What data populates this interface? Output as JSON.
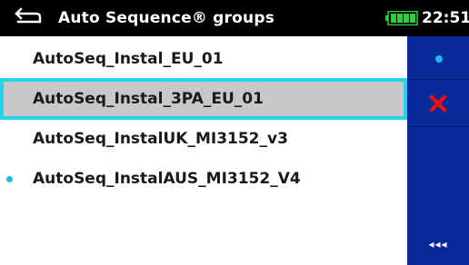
{
  "header": {
    "back_icon": "back-arrow-icon",
    "title": "Auto Sequence® groups",
    "battery_icon": "battery-full-icon",
    "battery_color": "#2dcf3a",
    "time": "22:51"
  },
  "list": {
    "items": [
      {
        "label": "AutoSeq_Instal_EU_01",
        "selected": false,
        "active": false
      },
      {
        "label": "AutoSeq_Instal_3PA_EU_01",
        "selected": true,
        "active": false
      },
      {
        "label": "AutoSeq_InstalUK_MI3152_v3",
        "selected": false,
        "active": false
      },
      {
        "label": "AutoSeq_InstalAUS_MI3152_V4",
        "selected": false,
        "active": true
      }
    ],
    "selection_border_color": "#27d3ea",
    "active_marker_color": "#1cb9f2"
  },
  "sidebar": {
    "background": "#082a98",
    "buttons": [
      {
        "icon": "set-active-dot-icon"
      },
      {
        "icon": "delete-x-icon",
        "color": "#e81010"
      },
      {
        "icon": "more-options-icon",
        "label": "◂◂◂"
      }
    ]
  }
}
